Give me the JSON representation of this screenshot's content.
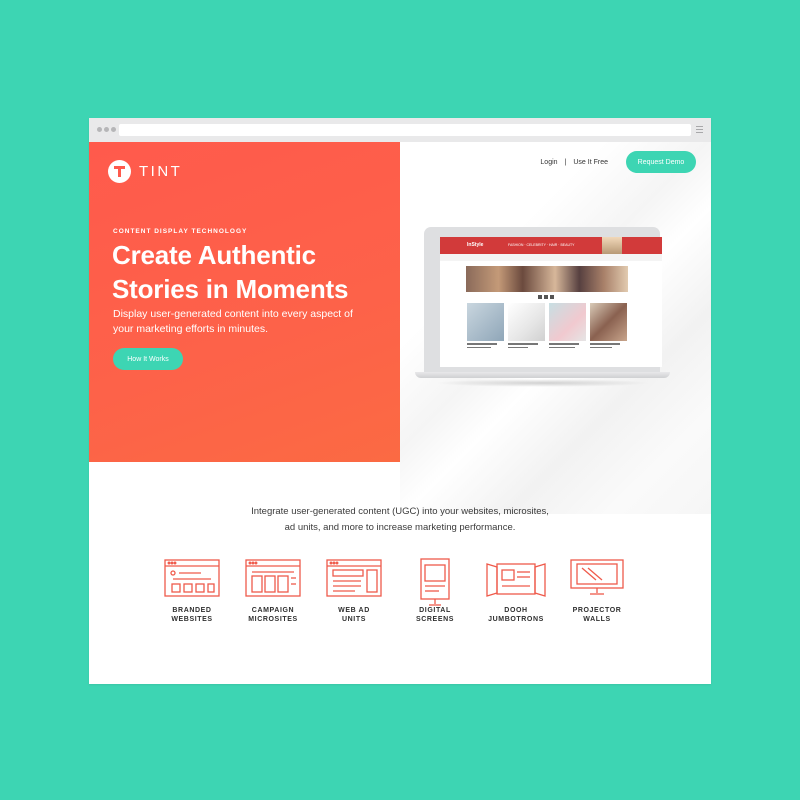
{
  "hero": {
    "logo_text": "TINT",
    "eyebrow": "CONTENT DISPLAY TECHNOLOGY",
    "headline": "Create Authentic Stories in Moments",
    "subcopy": "Display user-generated content into every aspect of your marketing efforts in minutes.",
    "cta_label": "How It Works"
  },
  "nav": {
    "login": "Login",
    "separator": "|",
    "use_free": "Use It Free",
    "demo": "Request Demo"
  },
  "mockup": {
    "site_logo": "InStyle",
    "site_nav": "FASHION · CELEBRITY · HAIR · BEAUTY"
  },
  "intro": {
    "line1": "Integrate user-generated content (UGC) into your websites, microsites,",
    "line2": "ad units, and more to increase marketing performance."
  },
  "features": [
    {
      "line1": "BRANDED",
      "line2": "WEBSITES",
      "icon": "branded-websites-icon"
    },
    {
      "line1": "CAMPAIGN",
      "line2": "MICROSITES",
      "icon": "campaign-microsites-icon"
    },
    {
      "line1": "WEB AD",
      "line2": "UNITS",
      "icon": "web-ad-units-icon"
    },
    {
      "line1": "DIGITAL",
      "line2": "SCREENS",
      "icon": "digital-screens-icon"
    },
    {
      "line1": "DOOH",
      "line2": "JUMBOTRONS",
      "icon": "dooh-jumbotrons-icon"
    },
    {
      "line1": "PROJECTOR",
      "line2": "WALLS",
      "icon": "projector-walls-icon"
    }
  ],
  "colors": {
    "background": "#3dd5b3",
    "hero": "#ff5a4c",
    "accent": "#3dd5b3",
    "icon_stroke": "#ef5a4b"
  }
}
